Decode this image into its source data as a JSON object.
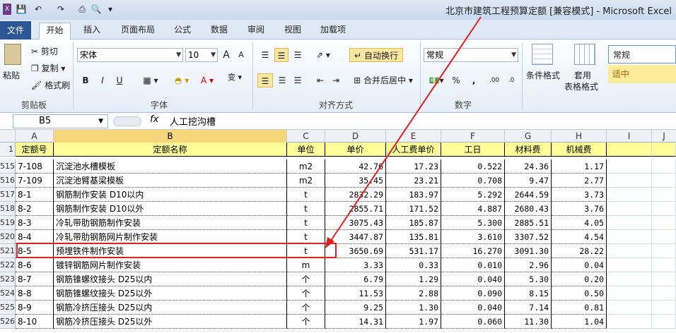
{
  "app": {
    "title": "北京市建筑工程预算定额 [兼容模式] - Microsoft Excel"
  },
  "quick_access": [
    "save",
    "undo",
    "redo",
    "print",
    "print-preview",
    "customize"
  ],
  "tabs": [
    "文件",
    "开始",
    "插入",
    "页面布局",
    "公式",
    "数据",
    "审阅",
    "视图",
    "加载项"
  ],
  "ribbon": {
    "clipboard": {
      "paste": "粘贴",
      "cut": "剪切",
      "copy": "复制",
      "format_painter": "格式刷",
      "group": "剪贴板"
    },
    "font": {
      "name": "宋体",
      "size": "10",
      "grow": "A",
      "shrink": "A",
      "bold": "B",
      "italic": "I",
      "underline": "U",
      "group": "字体"
    },
    "alignment": {
      "wrap": "自动换行",
      "merge": "合并后居中",
      "group": "对齐方式"
    },
    "number": {
      "format": "常规",
      "percent": "%",
      "comma": ",",
      "inc": ".00",
      "dec": ".0",
      "group": "数字"
    },
    "styles": {
      "conditional": "条件格式",
      "table": "套用",
      "table2": "表格格式",
      "normal": "常规",
      "medium": "适中"
    }
  },
  "formula_bar": {
    "cell": "B5",
    "fx": "fx",
    "value": "人工挖沟槽"
  },
  "columns": [
    "A",
    "B",
    "C",
    "D",
    "E",
    "F",
    "G",
    "H",
    "I",
    "J"
  ],
  "header_row": {
    "row": "1",
    "cells": [
      "定额号",
      "定额名称",
      "单位",
      "单价",
      "人工费单价",
      "工日",
      "材料费",
      "机械费"
    ]
  },
  "rows": [
    {
      "rh": "515",
      "cells": [
        "7-108",
        "沉淀池水槽模板",
        "m2",
        "42.76",
        "17.23",
        "0.522",
        "24.36",
        "1.17"
      ]
    },
    {
      "rh": "516",
      "cells": [
        "7-109",
        "沉淀池臂基梁模板",
        "m2",
        "35.45",
        "23.21",
        "0.708",
        "9.47",
        "2.77"
      ]
    },
    {
      "rh": "517",
      "cells": [
        "8-1",
        "钢筋制作安装 D10以内",
        "t",
        "2832.29",
        "183.97",
        "5.292",
        "2644.59",
        "3.73"
      ]
    },
    {
      "rh": "518",
      "cells": [
        "8-2",
        "钢筋制作安装 D10以外",
        "t",
        "2855.71",
        "171.52",
        "4.887",
        "2680.43",
        "3.76"
      ]
    },
    {
      "rh": "519",
      "cells": [
        "8-3",
        "冷轧带肋钢筋制作安装",
        "t",
        "3075.43",
        "185.87",
        "5.300",
        "2885.51",
        "4.05"
      ]
    },
    {
      "rh": "520",
      "cells": [
        "8-4",
        "冷轧带肋钢筋网片制作安装",
        "t",
        "3447.87",
        "135.81",
        "3.610",
        "3307.52",
        "4.54"
      ]
    },
    {
      "rh": "521",
      "cells": [
        "8-5",
        "预埋铁件制作安装",
        "t",
        "3650.69",
        "531.17",
        "16.270",
        "3091.30",
        "28.22"
      ]
    },
    {
      "rh": "522",
      "cells": [
        "8-6",
        "镀锌钢筋网片制作安装",
        "m",
        "3.33",
        "0.33",
        "0.010",
        "2.96",
        "0.04"
      ]
    },
    {
      "rh": "523",
      "cells": [
        "8-7",
        "钢筋锥螺纹接头 D25以内",
        "个",
        "6.79",
        "1.29",
        "0.040",
        "5.30",
        "0.20"
      ]
    },
    {
      "rh": "524",
      "cells": [
        "8-8",
        "钢筋锥螺纹接头 D25以外",
        "个",
        "11.53",
        "2.88",
        "0.090",
        "8.15",
        "0.50"
      ]
    },
    {
      "rh": "525",
      "cells": [
        "8-9",
        "钢筋冷挤压接头 D25以内",
        "个",
        "9.25",
        "1.30",
        "0.040",
        "7.14",
        "0.81"
      ]
    },
    {
      "rh": "526",
      "cells": [
        "8-10",
        "钢筋冷挤压接头 D25以外",
        "个",
        "14.31",
        "1.97",
        "0.060",
        "11.30",
        "1.04"
      ]
    }
  ],
  "colors": {
    "annotation": "#e02020",
    "header_fill": "#ffff99",
    "file_tab": "#2b5797"
  }
}
